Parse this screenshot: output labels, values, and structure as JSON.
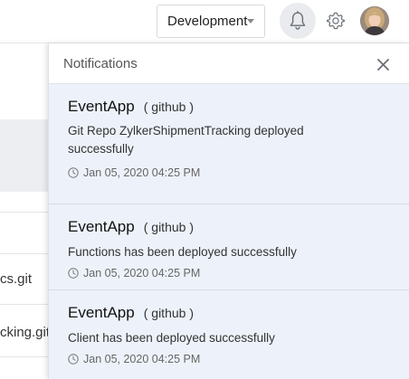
{
  "header": {
    "environment": "Development"
  },
  "background": {
    "row_texts": [
      "cs.git",
      "cking.git"
    ]
  },
  "notifications": {
    "title": "Notifications",
    "items": [
      {
        "app": "EventApp",
        "source": "( github )",
        "message": "Git Repo ZylkerShipmentTracking deployed successfully",
        "time": "Jan 05, 2020 04:25 PM"
      },
      {
        "app": "EventApp",
        "source": "( github )",
        "message": "Functions has been deployed successfully",
        "time": "Jan 05, 2020 04:25 PM"
      },
      {
        "app": "EventApp",
        "source": "( github )",
        "message": "Client has been deployed successfully",
        "time": "Jan 05, 2020 04:25 PM"
      }
    ]
  },
  "colors": {
    "panel_background": "#edf2fa",
    "bell_highlight": "#e9ebee"
  }
}
